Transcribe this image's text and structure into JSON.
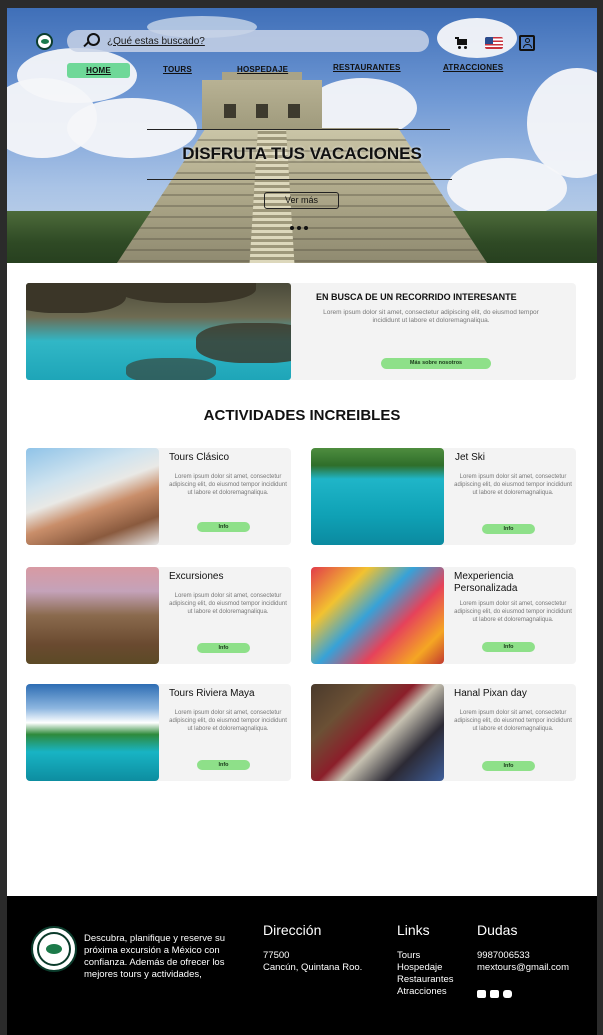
{
  "header": {
    "search_placeholder": "¿Qué estas buscado?",
    "nav": [
      "HOME",
      "TOURS",
      "HOSPEDAJE",
      "RESTAURANTES",
      "ATRACCIONES"
    ]
  },
  "hero": {
    "title": "DISFRUTA TUS VACACIONES",
    "button": "Ver más"
  },
  "promo": {
    "title": "EN BUSCA DE UN RECORRIDO INTERESANTE",
    "text": "Lorem ipsum dolor sit amet, consectetur adipiscing elit, do eiusmod tempor incididunt ut labore et doloremagnaliqua.",
    "button": "Más sobre nosotros"
  },
  "activities": {
    "title": "ACTIVIDADES INCREIBLES",
    "lorem": "Lorem ipsum dolor sit amet, consectetur adipiscing elit, do eiusmod tempor incididunt ut labore et doloremagnaliqua.",
    "button": "Info",
    "items": [
      {
        "title": "Tours Clásico"
      },
      {
        "title": "Jet Ski"
      },
      {
        "title": "Excursiones"
      },
      {
        "title": "Mexperiencia Personalizada"
      },
      {
        "title": "Tours Riviera Maya"
      },
      {
        "title": "Hanal Pixan day"
      }
    ]
  },
  "footer": {
    "description": "Descubra, planifique y reserve su próxima excursión a México con confianza. Además de ofrecer los mejores tours y actividades,",
    "address_title": "Dirección",
    "address_lines": [
      "77500",
      "Cancún, Quintana Roo."
    ],
    "links_title": "Links",
    "links": [
      "Tours",
      "Hospedaje",
      "Restaurantes",
      "Atracciones"
    ],
    "contact_title": "Dudas",
    "phone": "9987006533",
    "email": "mextours@gmail.com"
  },
  "colors": {
    "accent_green": "#8ee089",
    "nav_active": "#6fd898",
    "footer_bg": "#000000"
  },
  "icons": [
    "logo-icon",
    "search-icon",
    "cart-icon",
    "us-flag-icon",
    "user-icon",
    "twitter-icon",
    "facebook-icon",
    "instagram-icon"
  ]
}
